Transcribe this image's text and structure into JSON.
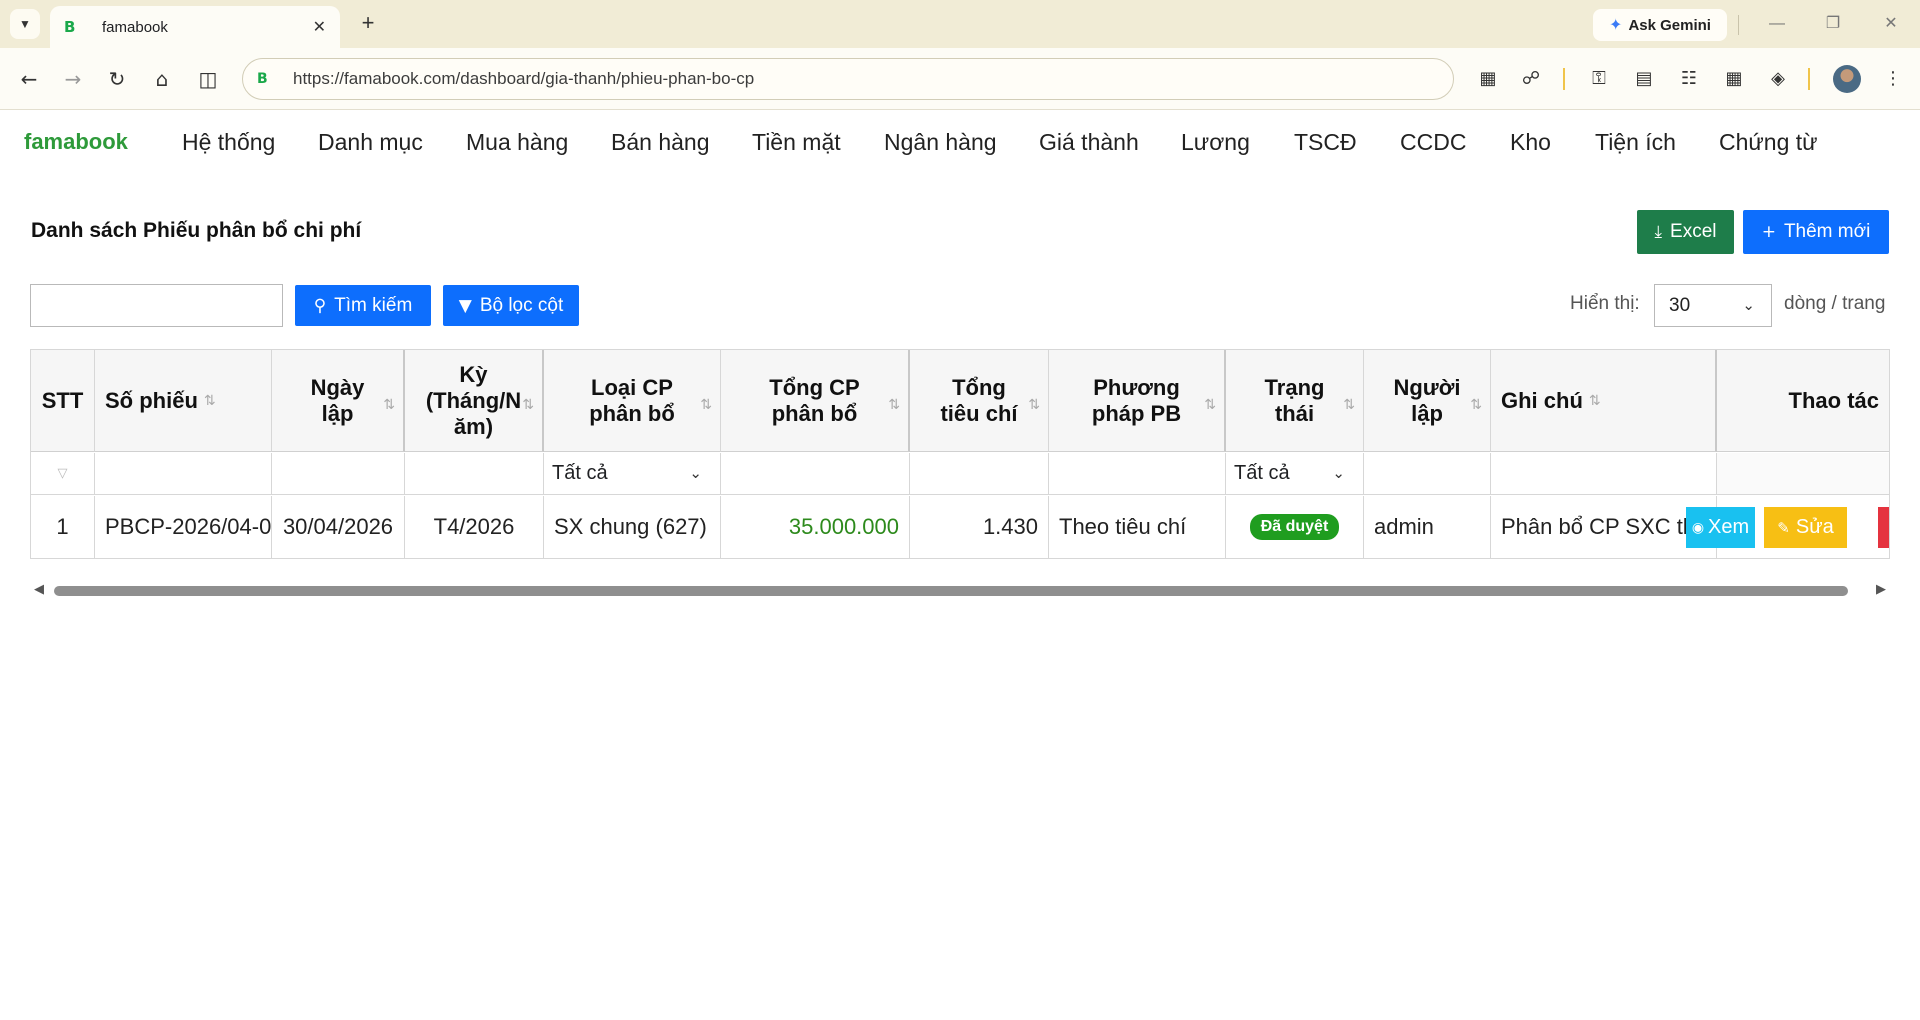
{
  "browser": {
    "tab_title": "famabook",
    "tab_favicon": "B",
    "new_tab_label": "+",
    "gemini_label": "Ask Gemini",
    "url": "https://famabook.com/dashboard/gia-thanh/phieu-phan-bo-cp"
  },
  "app": {
    "brand": "famabook",
    "menu": [
      "Hệ thống",
      "Danh mục",
      "Mua hàng",
      "Bán hàng",
      "Tiền mặt",
      "Ngân hàng",
      "Giá thành",
      "Lương",
      "TSCĐ",
      "CCDC",
      "Kho",
      "Tiện ích",
      "Chứng từ"
    ]
  },
  "page": {
    "title": "Danh sách Phiếu phân bổ chi phí",
    "excel_label": "Excel",
    "add_label": "Thêm mới",
    "search_placeholder": "",
    "search_label": "Tìm kiếm",
    "filter_label": "Bộ lọc cột",
    "show_label": "Hiển thị:",
    "page_size": "30",
    "per_page_label": "dòng / trang"
  },
  "table": {
    "headers": {
      "stt": "STT",
      "so_phieu": "Số phiếu",
      "ngay_lap": "Ngày\nlập",
      "ky": "Kỳ\n(Tháng/N\năm)",
      "loai_cp": "Loại CP\nphân bổ",
      "tong_cp": "Tổng CP\nphân bổ",
      "tong_tieu_chi": "Tổng\ntiêu chí",
      "phuong_phap": "Phương\npháp PB",
      "trang_thai": "Trạng\nthái",
      "nguoi_lap": "Người\nlập",
      "ghi_chu": "Ghi chú",
      "thao_tac": "Thao tác"
    },
    "filters": {
      "loai_cp": "Tất cả",
      "trang_thai": "Tất cả"
    },
    "rows": [
      {
        "stt": "1",
        "so_phieu": "PBCP-2026/04-0",
        "ngay_lap": "30/04/2026",
        "ky": "T4/2026",
        "loai_cp": "SX chung (627)",
        "tong_cp": "35.000.000",
        "tong_tieu_chi": "1.430",
        "phuong_phap": "Theo tiêu chí",
        "trang_thai": "Đã duyệt",
        "nguoi_lap": "admin",
        "ghi_chu": "Phân bổ CP SXC thán",
        "view_label": "Xem",
        "edit_label": "Sửa"
      }
    ]
  },
  "colors": {
    "brand": "#2e9a3a",
    "primary": "#0d6efd",
    "excel": "#1e7d4a",
    "status_approved": "#1f9d1f",
    "view": "#19c1f0",
    "edit": "#f7bf14",
    "delete": "#e5333f"
  }
}
